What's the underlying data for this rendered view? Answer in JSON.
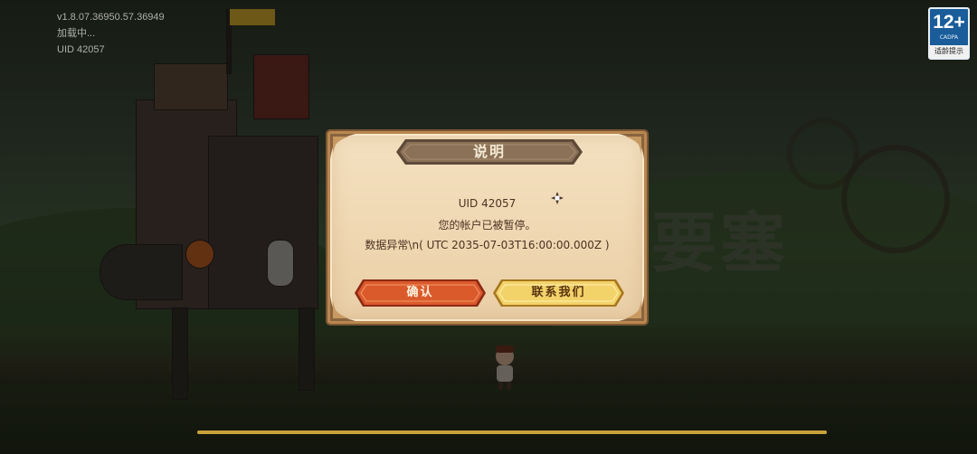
{
  "info": {
    "version": "v1.8.07.36950.57.36949",
    "loading": "加载中...",
    "uid": "UID 42057"
  },
  "age_badge": {
    "number": "12+",
    "sub": "CADPA",
    "footer": "适龄提示"
  },
  "background_title": "要塞",
  "dialog": {
    "title": "说明",
    "line1": "UID 42057",
    "line2": "您的帐户已被暂停。",
    "line3": "数据异常\\n( UTC 2035-07-03T16:00:00.000Z )",
    "confirm_label": "确认",
    "contact_label": "联系我们"
  },
  "loading_progress": 1.0,
  "colors": {
    "panel": "#efd7b2",
    "panel_border": "#b9874f",
    "title_ribbon": "#8a7158",
    "confirm_button": "#d9532a",
    "contact_button": "#f2d36a",
    "message_text": "#4b3322"
  }
}
